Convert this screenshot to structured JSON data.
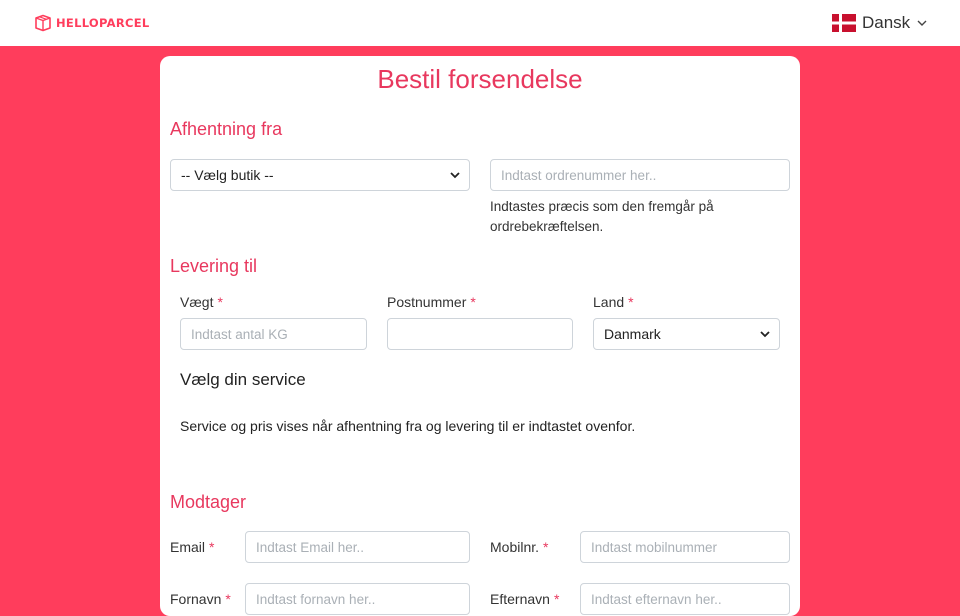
{
  "header": {
    "logo_text": "HELLOPARCEL",
    "language": "Dansk"
  },
  "page": {
    "title": "Bestil forsendelse"
  },
  "pickup": {
    "section_title": "Afhentning fra",
    "store_select": "-- Vælg butik --",
    "order_placeholder": "Indtast ordrenummer her..",
    "help_line1": "Indtastes præcis som den fremgår på",
    "help_line2": "ordrebekræftelsen."
  },
  "delivery": {
    "section_title": "Levering til",
    "weight_label": "Vægt",
    "weight_placeholder": "Indtast antal KG",
    "postal_label": "Postnummer",
    "country_label": "Land",
    "country_value": "Danmark",
    "required_mark": "*"
  },
  "service": {
    "title": "Vælg din service",
    "info": "Service og pris vises når afhentning fra og levering til er indtastet ovenfor."
  },
  "recipient": {
    "section_title": "Modtager",
    "email_label": "Email",
    "email_placeholder": "Indtast Email her..",
    "mobile_label": "Mobilnr.",
    "mobile_placeholder": "Indtast mobilnummer",
    "firstname_label": "Fornavn",
    "firstname_placeholder": "Indtast fornavn her..",
    "lastname_label": "Efternavn",
    "lastname_placeholder": "Indtast efternavn her..",
    "required_mark": "*"
  },
  "colors": {
    "brand": "#ff3d5c",
    "accent_text": "#e8385e"
  }
}
